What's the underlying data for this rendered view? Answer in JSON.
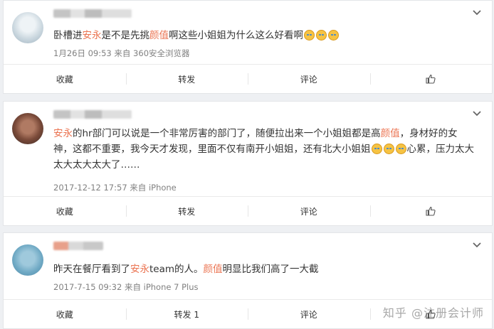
{
  "colors": {
    "highlight": "#eb7350",
    "text": "#333333",
    "meta": "#808080",
    "background": "#eef0f3"
  },
  "comments": [
    {
      "segments": [
        {
          "t": "卧槽进",
          "hl": false
        },
        {
          "t": "安永",
          "hl": true
        },
        {
          "t": "是不是先挑",
          "hl": false
        },
        {
          "t": "颜值",
          "hl": true
        },
        {
          "t": "啊这些小姐姐为什么这么好看啊",
          "hl": false
        }
      ],
      "emoji_count": 3,
      "meta": "1月26日 09:53 来自 360安全浏览器"
    },
    {
      "segments": [
        {
          "t": "安永",
          "hl": true
        },
        {
          "t": "的hr部门可以说是一个非常厉害的部门了，随便拉出来一个小姐姐都是高",
          "hl": false
        },
        {
          "t": "颜值",
          "hl": true
        },
        {
          "t": "，身材好的女神，这都不重要，我今天才发现，里面不仅有南开小姐姐，还有北大小姐姐",
          "hl": false
        },
        {
          "t": "[emoji3]",
          "hl": false
        },
        {
          "t": "心累，压力太大太大太大太大了……",
          "hl": false
        }
      ],
      "meta": "2017-12-12 17:57 来自 iPhone"
    },
    {
      "segments": [
        {
          "t": "昨天在餐厅看到了",
          "hl": false
        },
        {
          "t": "安永",
          "hl": true
        },
        {
          "t": "team的人。",
          "hl": false
        },
        {
          "t": "颜值",
          "hl": true
        },
        {
          "t": "明显比我们高了一大截",
          "hl": false
        }
      ],
      "meta": "2017-7-15 09:32 来自 iPhone 7 Plus"
    }
  ],
  "actions": [
    {
      "collect": "收藏",
      "repost": "转发",
      "comment": "评论",
      "like_icon": "thumbs-up-icon"
    },
    {
      "collect": "收藏",
      "repost": "转发",
      "comment": "评论",
      "like_icon": "thumbs-up-icon"
    },
    {
      "collect": "收藏",
      "repost": "转发 1",
      "comment": "评论",
      "like_icon": "thumbs-up-icon"
    }
  ],
  "watermark": "知乎 @注册会计师",
  "icons": {
    "menu": "chevron-down-icon",
    "like": "thumbs-up-icon"
  }
}
